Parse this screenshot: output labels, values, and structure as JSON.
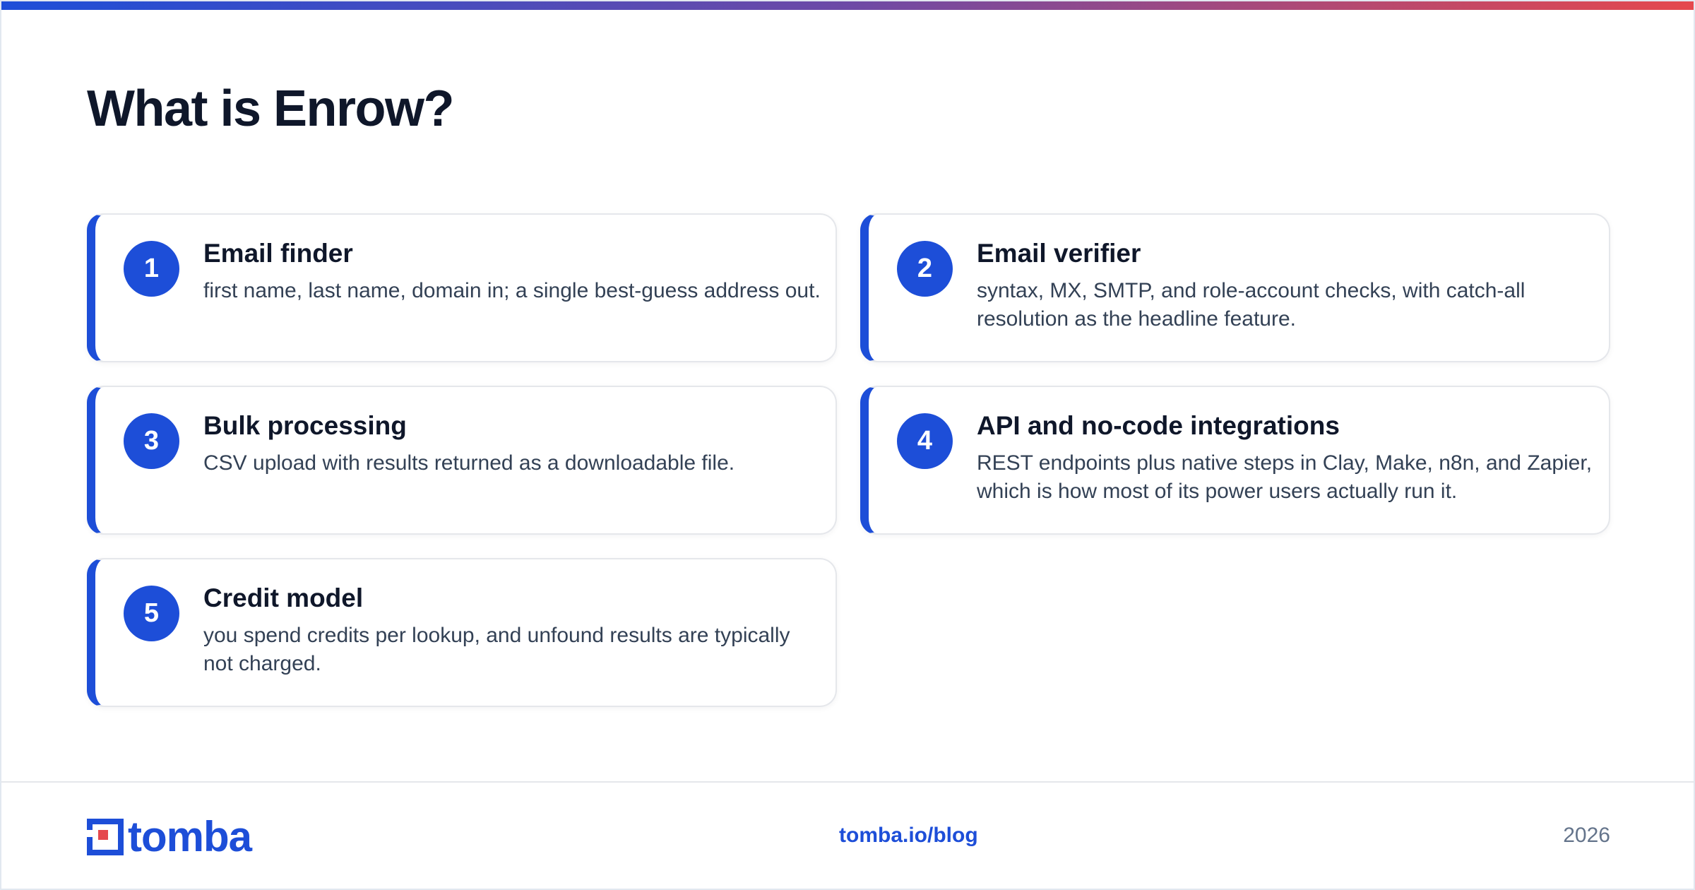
{
  "page": {
    "title": "What is Enrow?"
  },
  "cards": [
    {
      "number": "1",
      "title": "Email finder",
      "description": "first name, last name, domain in; a single best-guess address out."
    },
    {
      "number": "2",
      "title": "Email verifier",
      "description": "syntax, MX, SMTP, and role-account checks, with catch-all resolution as the headline feature."
    },
    {
      "number": "3",
      "title": "Bulk processing",
      "description": "CSV upload with results returned as a downloadable file."
    },
    {
      "number": "4",
      "title": "API and no-code integrations",
      "description": "REST endpoints plus native steps in Clay, Make, n8n, and Zapier, which is how most of its power users actually run it."
    },
    {
      "number": "5",
      "title": "Credit model",
      "description": "you spend credits per lookup, and unfound results are typically not charged."
    }
  ],
  "footer": {
    "logo_text": "tomba",
    "link": "tomba.io/blog",
    "year": "2026"
  },
  "colors": {
    "accent": "#1d4ed8",
    "logo_red": "#e5484d",
    "heading": "#0f172a",
    "body_text": "#334155",
    "muted": "#64748b"
  },
  "icons": {
    "logo": "tomba-logo-icon"
  }
}
